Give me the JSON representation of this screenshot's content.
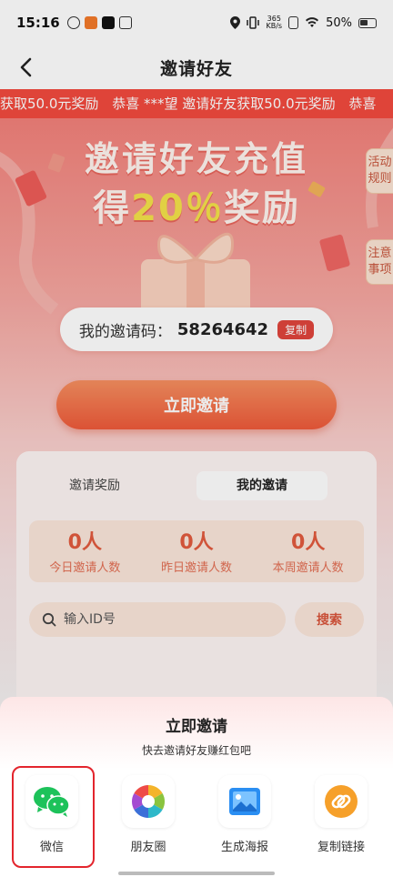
{
  "status_bar": {
    "time": "15:16",
    "net_speed_value": "365",
    "net_speed_unit": "KB/s",
    "battery": "50%"
  },
  "nav": {
    "title": "邀请好友"
  },
  "ticker": {
    "items": [
      "获取50.0元奖励",
      "恭喜 ***望 邀请好友获取50.0元奖励",
      "恭喜"
    ]
  },
  "hero": {
    "title_line1": "邀请好友充值",
    "title_line2_prefix": "得",
    "title_line2_accent": "20％",
    "title_line2_suffix": "奖励",
    "side_rules": "活动规则",
    "side_notes": "注意事项"
  },
  "invite_code": {
    "label": "我的邀请码：",
    "value": "58264642",
    "copy_label": "复制"
  },
  "invite_button": "立即邀请",
  "panel": {
    "tabs": [
      "邀请奖励",
      "我的邀请"
    ],
    "active_tab": "我的邀请",
    "stats": [
      {
        "value": "0人",
        "label": "今日邀请人数"
      },
      {
        "value": "0人",
        "label": "昨日邀请人数"
      },
      {
        "value": "0人",
        "label": "本周邀请人数"
      }
    ],
    "search": {
      "placeholder": "输入ID号",
      "button": "搜索"
    }
  },
  "sheet": {
    "title": "立即邀请",
    "subtitle": "快去邀请好友赚红包吧",
    "options": [
      {
        "label": "微信",
        "icon": "wechat-icon"
      },
      {
        "label": "朋友圈",
        "icon": "moments-icon"
      },
      {
        "label": "生成海报",
        "icon": "poster-icon"
      },
      {
        "label": "复制链接",
        "icon": "link-icon"
      }
    ]
  },
  "colors": {
    "accent": "#e0453c",
    "ticker_bg": "#f24a3e",
    "highlight": "#e3252d"
  }
}
